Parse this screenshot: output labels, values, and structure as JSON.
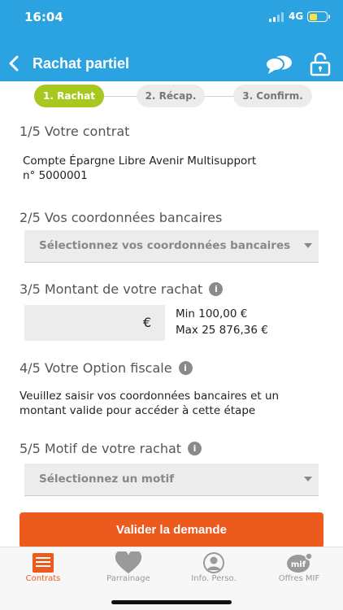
{
  "status": {
    "time": "16:04",
    "network": "4G"
  },
  "header": {
    "title": "Rachat partiel",
    "back_icon": "chevron-left-icon",
    "chat_icon": "chat-bubbles-icon",
    "lock_icon": "lock-icon"
  },
  "stepper": {
    "steps": [
      {
        "label": "1. Rachat"
      },
      {
        "label": "2. Récap."
      },
      {
        "label": "3. Confirm."
      }
    ]
  },
  "sections": {
    "contract": {
      "title": "1/5 Votre contrat",
      "line1": "Compte Épargne Libre Avenir Multisupport",
      "line2": "n° 5000001"
    },
    "bank": {
      "title": "2/5 Vos coordonnées bancaires",
      "select_label": "Sélectionnez vos coordonnées bancaires"
    },
    "amount": {
      "title": "3/5 Montant de votre rachat",
      "currency": "€",
      "min": "Min 100,00 €",
      "max": "Max 25 876,36 €"
    },
    "tax": {
      "title": "4/5 Votre Option fiscale",
      "message_line1": "Veuillez saisir vos coordonnées bancaires et un",
      "message_line2": "montant valide pour accéder à cette étape"
    },
    "reason": {
      "title": "5/5 Motif de votre rachat",
      "select_label": "Sélectionnez un motif"
    }
  },
  "info_icon": "i",
  "validate_button": "Valider la demande",
  "tabbar": {
    "tabs": [
      {
        "label": "Contrats",
        "icon": "contract-icon"
      },
      {
        "label": "Parrainage",
        "icon": "heart-icon"
      },
      {
        "label": "Info. Perso.",
        "icon": "profile-icon"
      },
      {
        "label": "Offres MIF",
        "icon": "mif-offers-icon",
        "badge": "mif"
      }
    ]
  },
  "colors": {
    "header": "#2aa3e0",
    "step_active": "#a8c820",
    "button": "#ec5a1d",
    "tab_active": "#ec5a1d"
  }
}
